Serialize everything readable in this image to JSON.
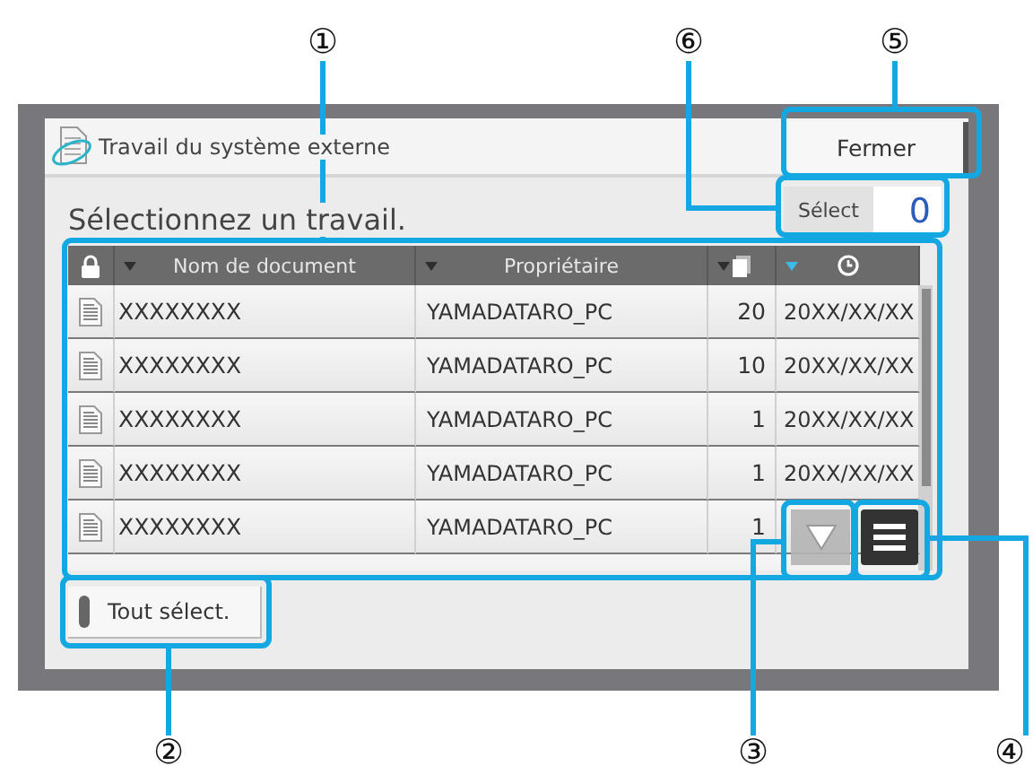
{
  "window": {
    "title": "Travail du système externe"
  },
  "close_button": "Fermer",
  "prompt": "Sélectionnez un travail.",
  "selected_count": {
    "label": "Sélect",
    "value": "0"
  },
  "table": {
    "columns": [
      {
        "kind": "lock"
      },
      {
        "kind": "text",
        "label": "Nom de document",
        "sorted": false
      },
      {
        "kind": "text",
        "label": "Propriétaire",
        "sorted": false
      },
      {
        "kind": "copies",
        "sorted": false
      },
      {
        "kind": "date",
        "sorted": true
      }
    ],
    "rows": [
      {
        "name": "XXXXXXXX",
        "owner": "YAMADATARO_PC",
        "copies": "20",
        "date": "20XX/XX/XX"
      },
      {
        "name": "XXXXXXXX",
        "owner": "YAMADATARO_PC",
        "copies": "10",
        "date": "20XX/XX/XX"
      },
      {
        "name": "XXXXXXXX",
        "owner": "YAMADATARO_PC",
        "copies": "1",
        "date": "20XX/XX/XX"
      },
      {
        "name": "XXXXXXXX",
        "owner": "YAMADATARO_PC",
        "copies": "1",
        "date": "20XX/XX/XX"
      },
      {
        "name": "XXXXXXXX",
        "owner": "YAMADATARO_PC",
        "copies": "1"
      }
    ]
  },
  "select_all_button": "Tout sélect.",
  "callouts": [
    "①",
    "⑥",
    "⑤",
    "②",
    "③",
    "④"
  ]
}
